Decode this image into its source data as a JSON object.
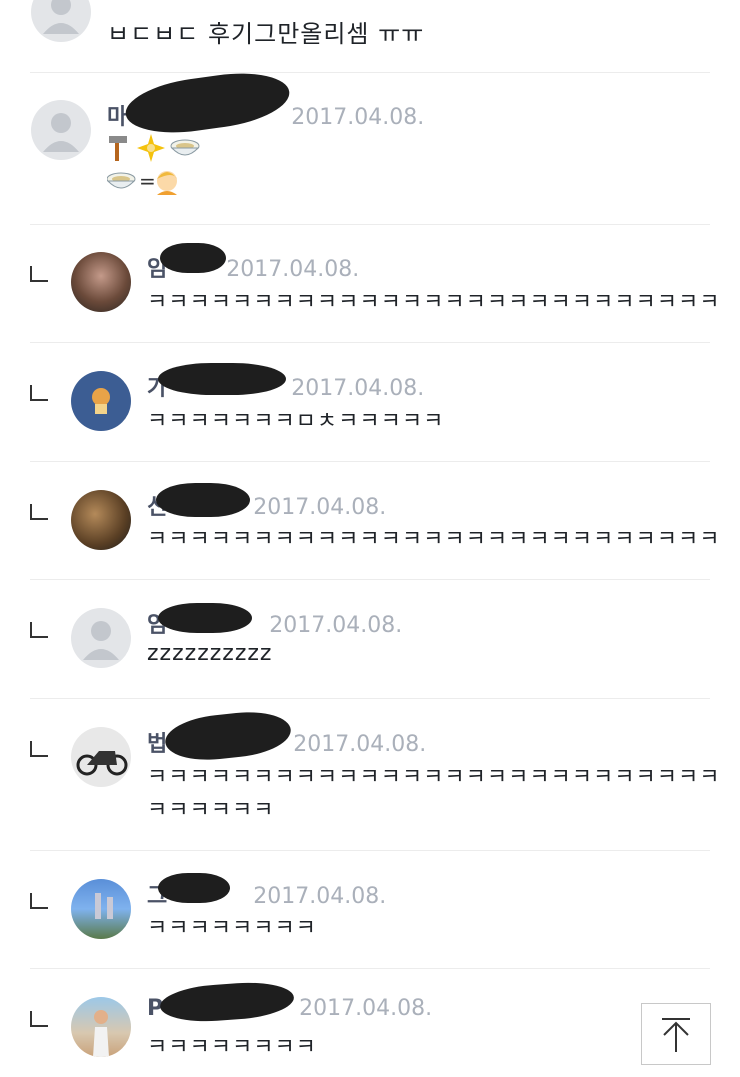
{
  "comments": [
    {
      "name": "",
      "date": "",
      "text": "ㅂㄷㅂㄷ 후기그만올리셈 ㅠㅠ"
    },
    {
      "name": "마",
      "date": "2017.04.08.",
      "text": ""
    },
    {
      "name": "임",
      "date": "2017.04.08.",
      "text": "ㅋㅋㅋㅋㅋㅋㅋㅋㅋㅋㅋㅋㅋㅋㅋㅋㅋㅋㅋㅋㅋㅋㅋㅋㅋㅋㅋ"
    },
    {
      "name": "가",
      "date": "2017.04.08.",
      "text": "ㅋㅋㅋㅋㅋㅋㅋㅁㅊㅋㅋㅋㅋㅋ"
    },
    {
      "name": "신",
      "date": "2017.04.08.",
      "text": "ㅋㅋㅋㅋㅋㅋㅋㅋㅋㅋㅋㅋㅋㅋㅋㅋㅋㅋㅋㅋㅋㅋㅋㅋㅋㅋㅋ"
    },
    {
      "name": "임",
      "date": "2017.04.08.",
      "text": "zzzzzzzzzz"
    },
    {
      "name": "법",
      "date": "2017.04.08.",
      "text": "ㅋㅋㅋㅋㅋㅋㅋㅋㅋㅋㅋㅋㅋㅋㅋㅋㅋㅋㅋㅋㅋㅋㅋㅋㅋㅋㅋ",
      "text2": "ㅋㅋㅋㅋㅋㅋ"
    },
    {
      "name": "그",
      "date": "2017.04.08.",
      "text": "ㅋㅋㅋㅋㅋㅋㅋㅋ"
    },
    {
      "name": "P",
      "date": "2017.04.08.",
      "text": "ㅋㅋㅋㅋㅋㅋㅋㅋ"
    }
  ],
  "emoji_line1": [
    "hammer-emoji",
    "sparkle-emoji",
    "bowl-emoji"
  ],
  "emoji_line2": [
    "bowl-emoji",
    "equals-sign",
    "face-emoji"
  ],
  "equals_text": "=",
  "scroll_top_icon": "arrow-up-to-top-icon"
}
